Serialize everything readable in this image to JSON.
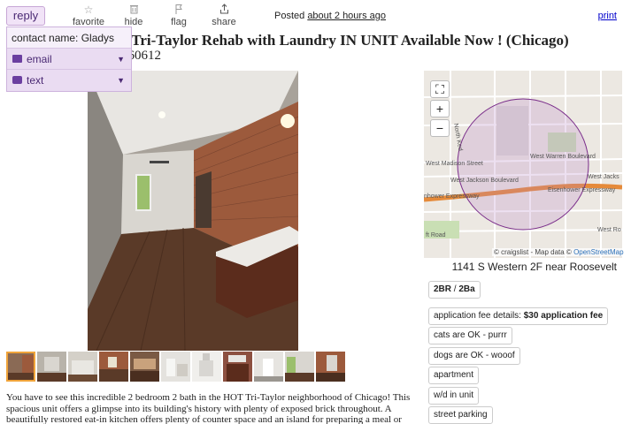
{
  "actions": {
    "reply_label": "reply",
    "favorite_label": "favorite",
    "favorite_icon": "star-icon",
    "hide_label": "hide",
    "hide_icon": "trash-icon",
    "flag_label": "flag",
    "flag_icon": "flag-icon",
    "share_label": "share",
    "share_icon": "share-icon"
  },
  "posted": {
    "prefix": "Posted",
    "time": "about 2 hours ago"
  },
  "print_label": "print",
  "reply_panel": {
    "contact": "contact name: Gladys",
    "options": [
      {
        "label": "email",
        "icon": "email-icon"
      },
      {
        "label": "text",
        "icon": "chat-icon"
      }
    ]
  },
  "title": {
    "visible_text": "EOUS Tri-Taylor Rehab with Laundry IN UNIT Available Now ! (Chicago)",
    "location_visible": "ago, IL 60612"
  },
  "map": {
    "streets": [
      "West Madison Street",
      "West Warren Boulevard",
      "West Jackson Boulevard",
      "West Jacks",
      "Eisenhower Expressway",
      "nhower Expressway",
      "ft Road",
      "West Ro",
      "North Ked"
    ],
    "attribution_prefix": "© craigslist - Map data ©",
    "attribution_link": "OpenStreetMap",
    "address": "1141 S Western 2F near Roosevelt"
  },
  "attributes": {
    "bed_bath": {
      "br": "2BR",
      "sep": " / ",
      "ba": "2Ba"
    },
    "fee": {
      "label": "application fee details: ",
      "value": "$30 application fee"
    },
    "items": [
      "cats are OK - purrr",
      "dogs are OK - wooof",
      "apartment",
      "w/d in unit",
      "street parking"
    ]
  },
  "description": "You have to see this incredible 2 bedroom 2 bath in the HOT Tri-Taylor neighborhood of Chicago! This spacious unit offers a glimpse into its building's history with plenty of exposed brick throughout. A beautifully restored eat-in kitchen offers plenty of counter space and an island for preparing a meal or",
  "colors": {
    "reply_bg": "#f1e3f7",
    "reply_text": "#4b2a74",
    "link": "#0000cc",
    "map_circle": "#7a2d8a",
    "expressway": "#e58a3a"
  }
}
